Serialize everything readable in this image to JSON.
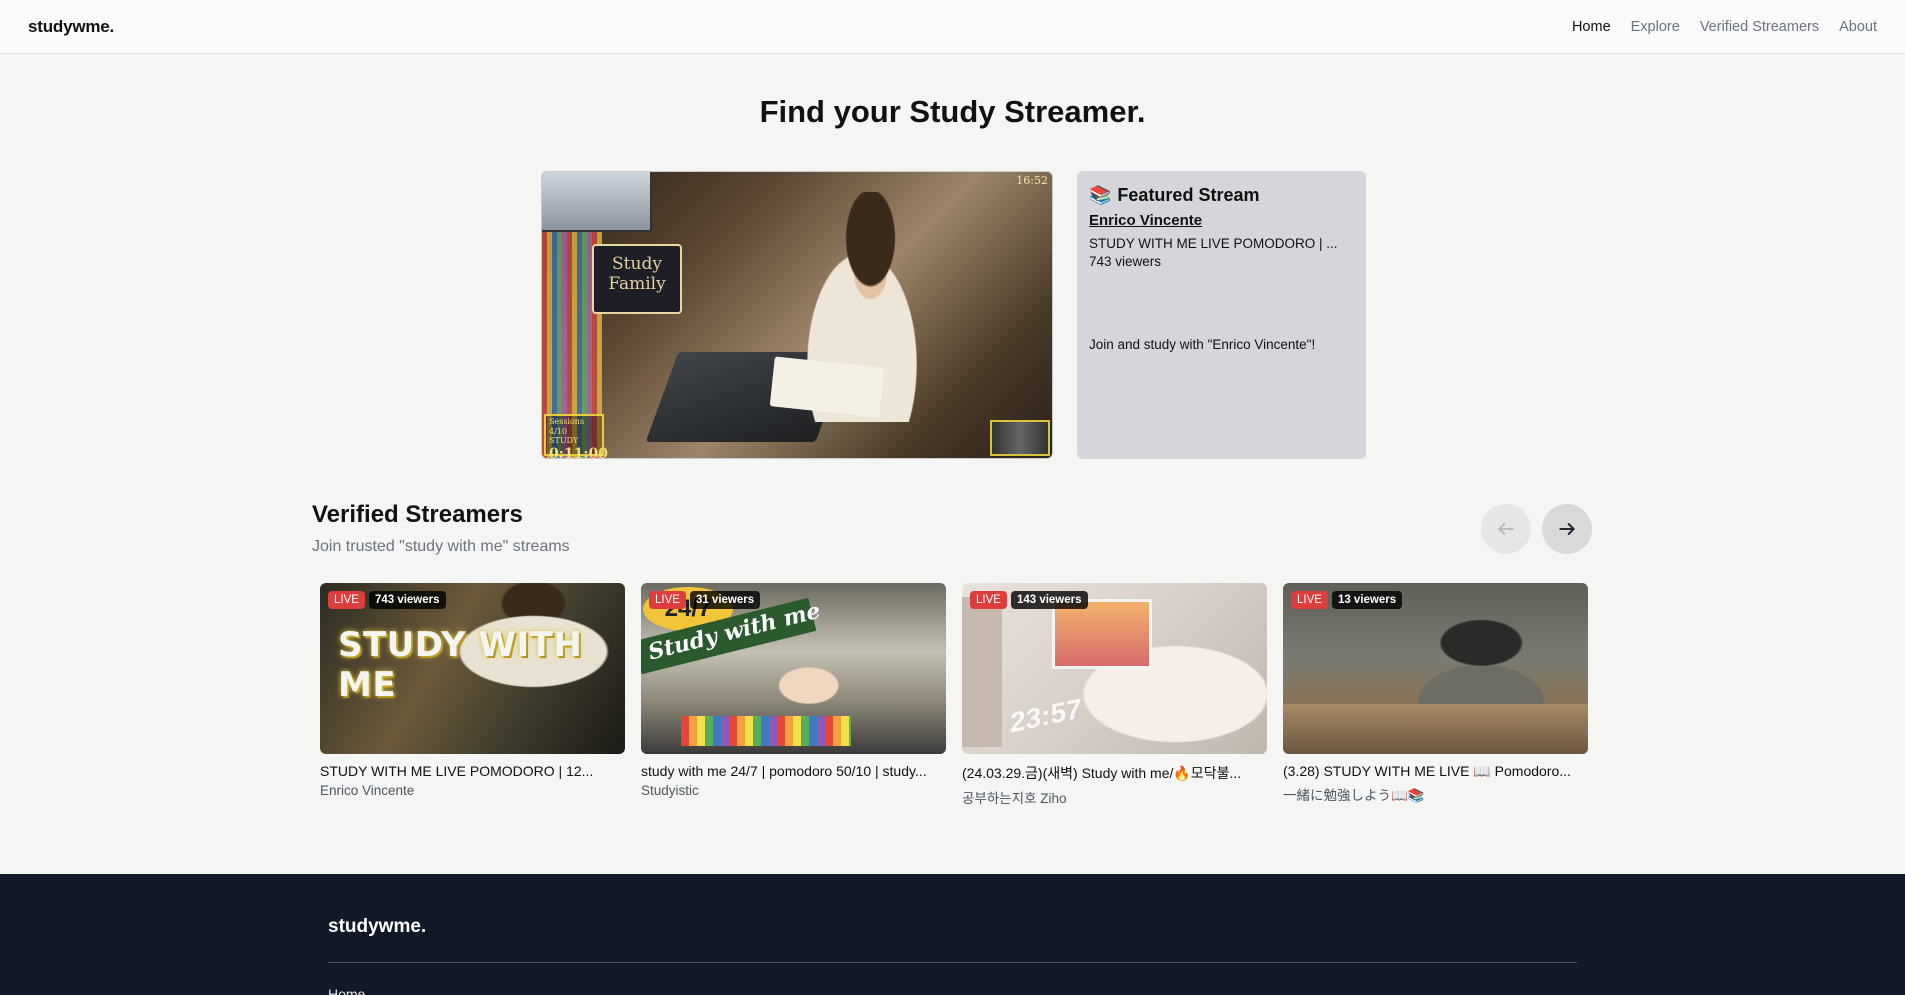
{
  "nav": {
    "logo": "studywme.",
    "links": [
      {
        "label": "Home",
        "active": true
      },
      {
        "label": "Explore",
        "active": false
      },
      {
        "label": "Verified Streamers",
        "active": false
      },
      {
        "label": "About",
        "active": false
      }
    ]
  },
  "hero": {
    "title": "Find your Study Streamer."
  },
  "featured_video": {
    "sign_text": "Study Family",
    "time": "16:52",
    "timer_sessions": "Sessions 4/10",
    "timer_label": "STUDY",
    "timer_value": "0:11:00"
  },
  "featured": {
    "emoji": "📚",
    "title": "Featured Stream",
    "streamer": "Enrico Vincente",
    "stream_title": "STUDY WITH ME LIVE POMODORO | ...",
    "viewers": "743 viewers",
    "join_text": "Join and study with \"Enrico Vincente\"!"
  },
  "verified": {
    "title": "Verified Streamers",
    "subtitle": "Join trusted \"study with me\" streams",
    "prev_icon": "arrow-left-icon",
    "next_icon": "arrow-right-icon",
    "cards": [
      {
        "live": "LIVE",
        "viewers": "743 viewers",
        "title": "STUDY WITH ME LIVE POMODORO | 12...",
        "channel": "Enrico Vincente",
        "thumb_text": "STUDY WITH ME"
      },
      {
        "live": "LIVE",
        "viewers": "31 viewers",
        "title": "study with me 24/7 | pomodoro 50/10 | study...",
        "channel": "Studyistic",
        "thumb_text": "Study with me",
        "thumb_badge": "24/7"
      },
      {
        "live": "LIVE",
        "viewers": "143 viewers",
        "title": "(24.03.29.금)(새벽) Study with me/🔥모닥불...",
        "channel": "공부하는지호 Ziho",
        "thumb_text": "23:57"
      },
      {
        "live": "LIVE",
        "viewers": "13 viewers",
        "title": "(3.28) STUDY WITH ME LIVE 📖 Pomodoro...",
        "channel": "一緒に勉強しよう📖📚"
      }
    ]
  },
  "footer": {
    "logo": "studywme.",
    "home": "Home"
  },
  "colors": {
    "live_badge": "#dc3d3d",
    "footer_bg": "#111827",
    "featured_card_bg": "#d4d6dc"
  }
}
